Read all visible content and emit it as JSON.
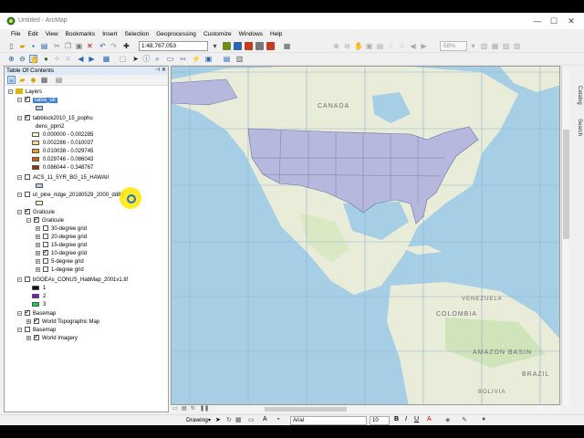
{
  "window": {
    "title": "Untitled - ArcMap",
    "controls": {
      "minimize": "—",
      "maximize": "☐",
      "close": "✕"
    }
  },
  "menu": [
    "File",
    "Edit",
    "View",
    "Bookmarks",
    "Insert",
    "Selection",
    "Geoprocessing",
    "Customize",
    "Windows",
    "Help"
  ],
  "toolbar": {
    "scale": "1:48,767,053",
    "zoom_percent": "58%"
  },
  "toc": {
    "title": "Table Of Contents",
    "root_label": "Layers",
    "layers": [
      {
        "label": "tabla_uti",
        "checked": true,
        "selected": true
      },
      {
        "label": "tabblock2010_15_pophu",
        "checked": true,
        "field": "dens_ppm2",
        "classes": [
          {
            "label": "0.000000 - 0.002285",
            "color": "#ffffd4"
          },
          {
            "label": "0.002286 - 0.010037",
            "color": "#fed98e"
          },
          {
            "label": "0.010038 - 0.029745",
            "color": "#fe9929"
          },
          {
            "label": "0.029746 - 0.086043",
            "color": "#d95f0e"
          },
          {
            "label": "0.086044 - 0.348767",
            "color": "#993404"
          }
        ]
      },
      {
        "label": "ACS_11_5YR_BG_15_HAWAII",
        "checked": false
      },
      {
        "label": "ut_pine_ridge_20180529_2000_dd83",
        "checked": false
      },
      {
        "label": "Graticule",
        "checked": true,
        "sublabel": "Graticule",
        "children": [
          {
            "label": "30-degree grid",
            "checked": false
          },
          {
            "label": "20-degree grid",
            "checked": false
          },
          {
            "label": "15-degree grid",
            "checked": false
          },
          {
            "label": "10-degree grid",
            "checked": true
          },
          {
            "label": "5-degree grid",
            "checked": false
          },
          {
            "label": "1-degree grid",
            "checked": false
          }
        ]
      },
      {
        "label": "bGOEAs_CONUS_HabMap_2001v1.tif",
        "checked": false,
        "classes": [
          {
            "label": "1",
            "color": "#111111"
          },
          {
            "label": "2",
            "color": "#7a17c4"
          },
          {
            "label": "3",
            "color": "#22c55e"
          }
        ]
      },
      {
        "label": "Basemap",
        "checked": true,
        "child": "World Topographic Map"
      },
      {
        "label": "Basemap",
        "checked": false,
        "child": "World Imagery"
      }
    ]
  },
  "map": {
    "labels": [
      "CANADA",
      "COLOMBIA",
      "VENEZUELA",
      "AMAZON BASIN",
      "BRAZIL",
      "BOLIVIA"
    ]
  },
  "side_tabs": [
    "Catalog",
    "Search"
  ],
  "drawing": {
    "label": "Drawing",
    "font": "Arial",
    "size": "10"
  },
  "colors": {
    "us_fill": "#b6b9dd",
    "water": "#a6cfe6",
    "land": "#e9ecd9",
    "selection": "#3c7fd5"
  }
}
